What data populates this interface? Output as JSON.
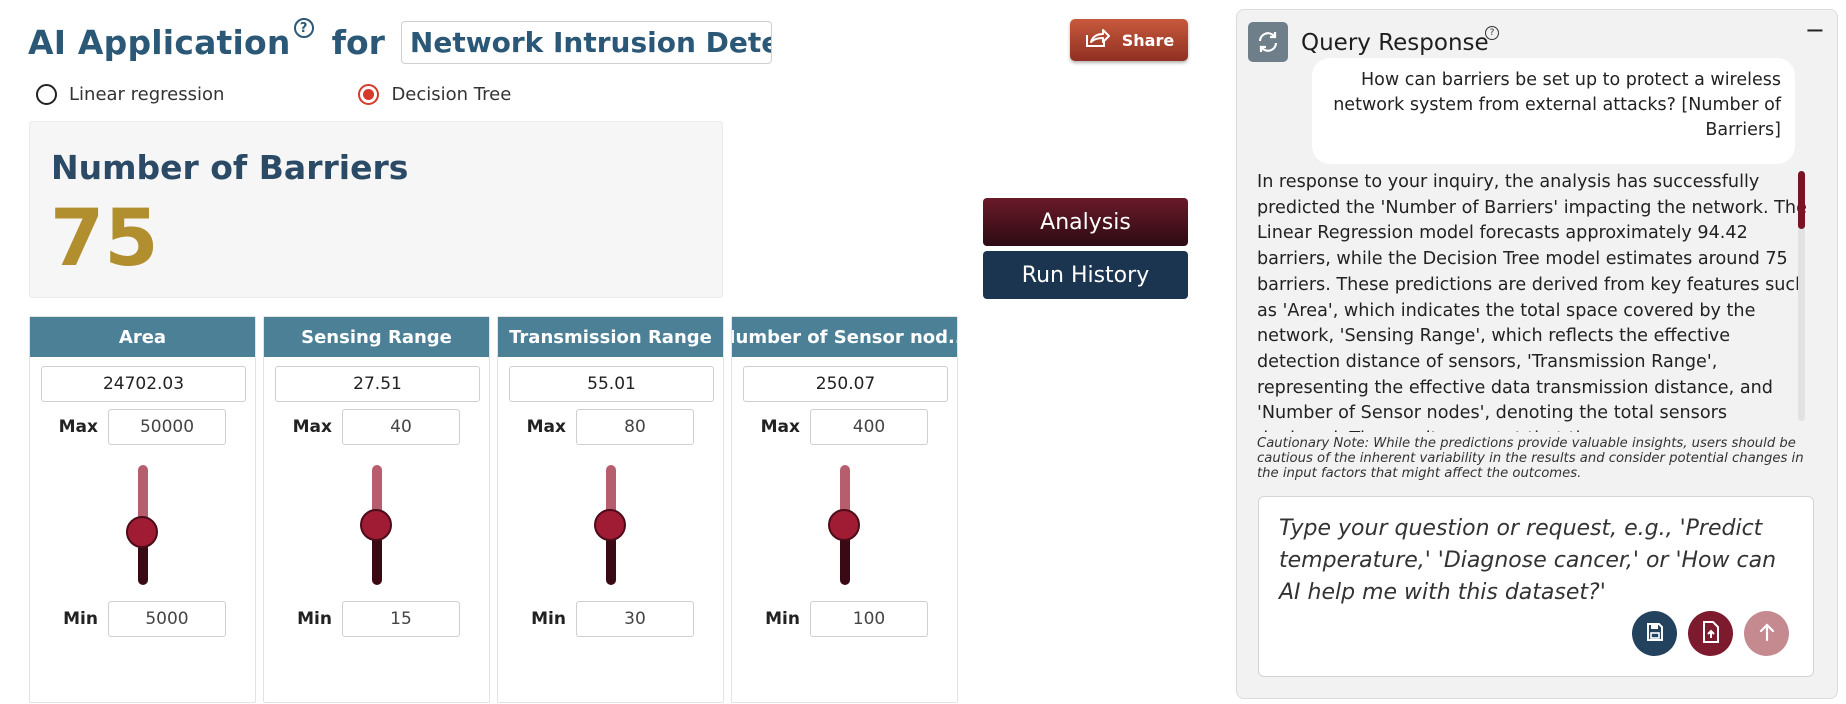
{
  "header": {
    "app_title": "AI Application",
    "help_glyph": "?",
    "for_label": "for",
    "dataset_name": "Network Intrusion Detect",
    "share_label": "Share"
  },
  "model_options": [
    {
      "label": "Linear regression",
      "selected": false
    },
    {
      "label": "Decision Tree",
      "selected": true
    }
  ],
  "result": {
    "label": "Number of Barriers",
    "value": "75"
  },
  "actions": {
    "analysis_label": "Analysis",
    "history_label": "Run History"
  },
  "features": [
    {
      "name": "Area",
      "value": "24702.03",
      "max_label": "Max",
      "max": "50000",
      "min_label": "Min",
      "min": "5000",
      "level": 0.44
    },
    {
      "name": "Sensing Range",
      "value": "27.51",
      "max_label": "Max",
      "max": "40",
      "min_label": "Min",
      "min": "15",
      "level": 0.5
    },
    {
      "name": "Transmission Range",
      "value": "55.01",
      "max_label": "Max",
      "max": "80",
      "min_label": "Min",
      "min": "30",
      "level": 0.5
    },
    {
      "name": "Number of Sensor nod...",
      "value": "250.07",
      "max_label": "Max",
      "max": "400",
      "min_label": "Min",
      "min": "100",
      "level": 0.5
    }
  ],
  "panel": {
    "title": "Query Response",
    "help_glyph": "?",
    "minimize_glyph": "−",
    "user_question": "How can barriers be set up to protect a wireless network system from external attacks? [Number of Barriers]",
    "answer": "In response to your inquiry, the analysis has successfully predicted the 'Number of Barriers' impacting the network. The Linear Regression model forecasts approximately 94.42 barriers, while the Decision Tree model estimates around 75 barriers. These predictions are derived from key features such as 'Area', which indicates the total space covered by the network, 'Sensing Range', which reflects the effective detection distance of sensors, 'Transmission Range', representing the effective data transmission distance, and 'Number of Sensor nodes', denoting the total sensors deployed. The results suggest that the",
    "caution": "Cautionary Note: While the predictions provide valuable insights, users should be cautious of the inherent variability in the results and consider potential changes in the input factors that might affect the outcomes.",
    "query_placeholder": "Type your question or request, e.g., 'Predict temperature,' 'Diagnose cancer,' or 'How can AI help me with this dataset?'"
  },
  "colors": {
    "title_blue": "#2b5876",
    "accent_gold": "#b18e2e",
    "header_teal": "#4c8097",
    "slider_red": "#a01c34"
  },
  "icons": [
    "help-icon",
    "share-icon",
    "refresh-icon",
    "minimize-icon",
    "save-icon",
    "file-upload-icon",
    "arrow-up-icon"
  ]
}
